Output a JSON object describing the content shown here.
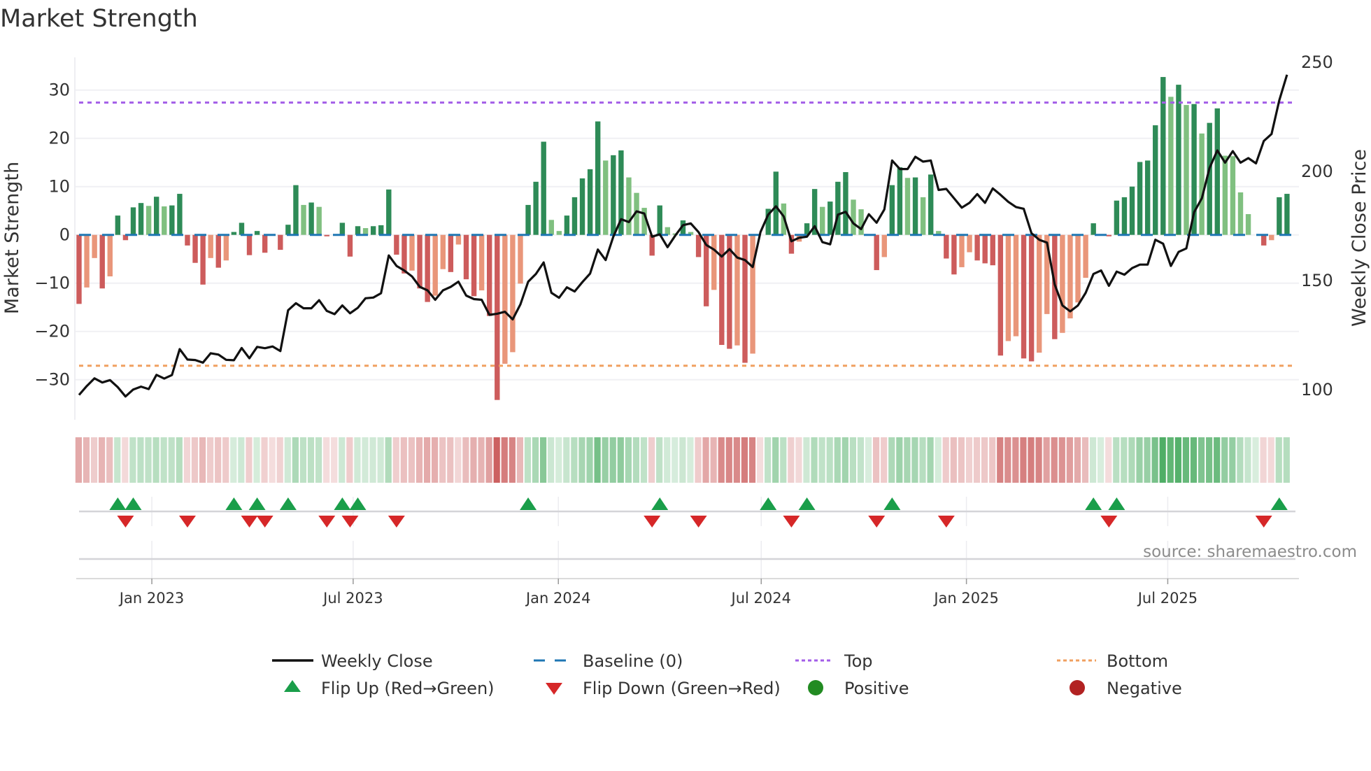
{
  "title": "Market Strength",
  "source": "source: sharemaestro.com",
  "legend": {
    "weekly_close": "Weekly Close",
    "baseline": "Baseline (0)",
    "top": "Top",
    "bottom": "Bottom",
    "flip_up": "Flip Up (Red→Green)",
    "flip_down": "Flip Down (Green→Red)",
    "positive": "Positive",
    "negative": "Negative"
  },
  "colors": {
    "rising_positive": "#2e8b57",
    "falling_positive": "#80c080",
    "falling_negative": "#cd5c5c",
    "rising_negative": "#e9967a",
    "baseline": "#1f77b4",
    "top": "#a35ee8",
    "bottom": "#f0a060",
    "price": "#111111",
    "flip_up": "#1a9e4a",
    "flip_down": "#d62728",
    "positive": "#228b22",
    "negative": "#b22222"
  },
  "chart_data": {
    "type": "bar",
    "title": "Market Strength",
    "xlabel": "",
    "ylabel": "Market Strength",
    "y2label": "Weekly Close Price",
    "ylim": [
      -37,
      37
    ],
    "y2lim": [
      92,
      255
    ],
    "y_ticks": [
      "30",
      "20",
      "10",
      "0",
      "−10",
      "−20",
      "−30"
    ],
    "y_tick_values": [
      30,
      20,
      10,
      0,
      -10,
      -20,
      -30
    ],
    "y2_ticks": [
      "250",
      "200",
      "150",
      "100"
    ],
    "y2_tick_values": [
      250,
      200,
      150,
      100
    ],
    "x_unit": "week index",
    "x_ticks": [
      "Jan 2023",
      "Jul 2023",
      "Jan 2024",
      "Jul 2024",
      "Jan 2025",
      "Jul 2025"
    ],
    "x_tick_values": [
      9.4,
      35.4,
      61.9,
      88.1,
      114.6,
      140.6
    ],
    "top_level": 27.4,
    "bottom_level": -27.1,
    "baseline": 0,
    "grid": true,
    "legend_position": "bottom",
    "series": [
      {
        "name": "Market Strength",
        "type": "bar",
        "values": [
          -14.3,
          -10.9,
          -4.8,
          -11.1,
          -8.6,
          4.0,
          -1.1,
          5.7,
          6.6,
          6.0,
          7.9,
          5.9,
          6.1,
          8.5,
          -2.2,
          -5.8,
          -10.3,
          -4.8,
          -6.8,
          -5.3,
          0.6,
          2.5,
          -4.2,
          0.8,
          -3.7,
          0,
          -3.1,
          2.1,
          10.3,
          6.2,
          6.7,
          5.8,
          -0.3,
          0,
          2.5,
          -4.5,
          1.8,
          1.4,
          1.8,
          2.0,
          9.4,
          -4.1,
          -8.0,
          -7.4,
          -11.1,
          -13.9,
          -12.6,
          -7.1,
          -7.7,
          -2.0,
          -9.2,
          -12.7,
          -11.5,
          -16.8,
          -34.2,
          -26.7,
          -24.3,
          -10.1,
          6.2,
          11.0,
          19.3,
          3.1,
          0.8,
          4.0,
          7.8,
          11.7,
          13.6,
          23.5,
          15.4,
          16.5,
          17.5,
          11.9,
          8.7,
          5.6,
          -4.3,
          6.1,
          1.6,
          0.3,
          3.0,
          0.6,
          -4.6,
          -14.8,
          -11.4,
          -22.8,
          -23.6,
          -22.9,
          -26.5,
          -24.6,
          0,
          5.4,
          13.1,
          6.5,
          -3.9,
          -1.4,
          2.4,
          9.5,
          5.8,
          6.9,
          11.0,
          13.0,
          7.3,
          5.3,
          0,
          -7.3,
          -4.6,
          10.3,
          14.0,
          11.8,
          11.9,
          7.8,
          12.5,
          0.8,
          -4.9,
          -8.2,
          -6.7,
          -3.6,
          -5.3,
          -5.9,
          -6.3,
          -25.0,
          -22.0,
          -21.0,
          -25.6,
          -26.2,
          -24.4,
          -16.4,
          -21.6,
          -20.3,
          -17.3,
          -14.0,
          -8.9,
          2.4,
          0,
          -0.3,
          7.1,
          7.8,
          10.0,
          15.1,
          15.4,
          22.7,
          32.7,
          28.6,
          31.1,
          26.9,
          27.1,
          21.0,
          23.2,
          26.2,
          16.4,
          16.3,
          8.8,
          4.3,
          0,
          -2.2,
          -1.1,
          7.8,
          8.5
        ]
      },
      {
        "name": "Weekly Close",
        "type": "line",
        "axis": "right",
        "values": [
          97.6,
          101.7,
          105.2,
          103.3,
          104.4,
          101.2,
          96.9,
          100.1,
          101.4,
          100.3,
          106.8,
          105.1,
          106.7,
          118.6,
          113.8,
          113.6,
          112.4,
          116.7,
          116.1,
          113.7,
          113.5,
          119.1,
          114.4,
          119.6,
          119.0,
          119.8,
          117.7,
          136.4,
          139.6,
          137.3,
          137.3,
          141.0,
          136.1,
          134.6,
          138.6,
          135.0,
          137.5,
          141.9,
          142.2,
          144.2,
          161.5,
          156.7,
          154.6,
          151.9,
          147.1,
          145.5,
          141.2,
          145.5,
          147.1,
          149.5,
          143.1,
          141.5,
          141.2,
          134.3,
          134.8,
          135.7,
          132.2,
          139.1,
          149.5,
          153.0,
          158.3,
          144.4,
          142.1,
          146.9,
          145.0,
          149.3,
          153.2,
          164.2,
          159.4,
          170.1,
          178.1,
          176.8,
          181.7,
          180.7,
          170.1,
          171.2,
          165.3,
          170.6,
          175.4,
          176.2,
          172.2,
          166.3,
          164.2,
          161.0,
          164.4,
          160.5,
          159.4,
          156.2,
          172.2,
          180.2,
          184.0,
          179.4,
          168.0,
          169.6,
          170.1,
          174.9,
          167.6,
          166.6,
          180.2,
          181.5,
          176.2,
          173.6,
          180.4,
          176.5,
          182.6,
          205.0,
          201.1,
          201.1,
          206.7,
          204.5,
          205.0,
          191.5,
          192.0,
          187.7,
          183.4,
          185.6,
          189.6,
          185.6,
          192.2,
          189.3,
          186.1,
          183.7,
          182.9,
          171.7,
          168.7,
          167.4,
          148.2,
          138.6,
          135.9,
          138.6,
          144.4,
          153.0,
          154.6,
          147.6,
          154.1,
          152.7,
          155.7,
          157.3,
          157.3,
          168.7,
          166.9,
          156.7,
          163.1,
          164.7,
          181.3,
          187.7,
          201.6,
          209.6,
          204.0,
          209.3,
          204.0,
          206.1,
          203.7,
          213.9,
          217.1,
          232.6,
          244.3
        ]
      }
    ]
  }
}
